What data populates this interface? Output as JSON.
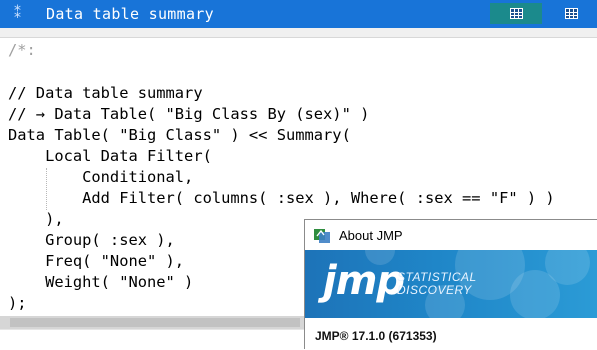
{
  "window": {
    "title": "Data table summary",
    "handle_icon": "drag-handle-icon",
    "buttons": [
      {
        "icon": "data-grid-icon"
      },
      {
        "icon": "data-grid-icon"
      }
    ]
  },
  "code": {
    "lines": [
      "/*:",
      "",
      "// Data table summary",
      "// → Data Table( \"Big Class By (sex)\" )",
      "Data Table( \"Big Class\" ) << Summary(",
      "    Local Data Filter(",
      "        Conditional,",
      "        Add Filter( columns( :sex ), Where( :sex == \"F\" ) )",
      "    ),",
      "    Group( :sex ),",
      "    Freq( \"None\" ),",
      "    Weight( \"None\" )",
      ");"
    ]
  },
  "about": {
    "title": "About JMP",
    "logo_text": "jmp",
    "tagline_1": "STATISTICAL",
    "tagline_2": "DISCOVERY",
    "version_product": "JMP®",
    "version_number": "17.1.0 (671353)",
    "accent_color": "#1f86c8"
  },
  "colors": {
    "titlebar": "#1874d8",
    "button_teal": "#1b8a8c"
  }
}
